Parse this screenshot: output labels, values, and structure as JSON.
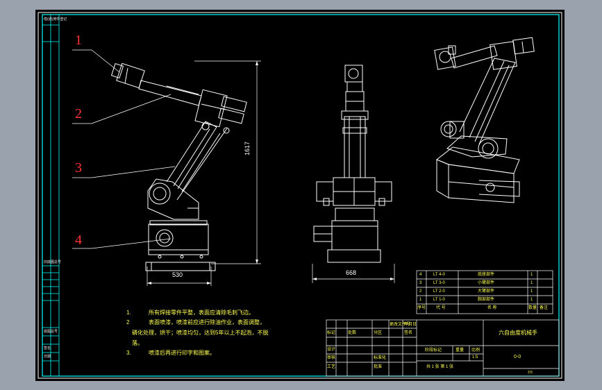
{
  "drawing": {
    "callouts": [
      "1",
      "2",
      "3",
      "4"
    ],
    "dim_width_side": "530",
    "dim_height": "1617",
    "dim_width_front": "668",
    "notes": [
      {
        "num": "1.",
        "text": "所有焊接零件平整，表面应清除毛刺飞边。"
      },
      {
        "num": "2",
        "text": "表面喷漆，喷漆前应进行除油作业，表面调整，"
      },
      {
        "num": "",
        "text": "磷化处理，烘干；喷漆均匀，达到5年以上不起泡，不脱"
      },
      {
        "num": "",
        "text": "落。"
      },
      {
        "num": "3.",
        "text": "喷漆后再进行印字和图案。"
      }
    ]
  },
  "bom": {
    "rows": [
      {
        "no": "4",
        "code": "LT 4-0",
        "name": "底座部件",
        "qty": "1"
      },
      {
        "no": "3",
        "code": "LT 3-0",
        "name": "小臂部件",
        "qty": "1"
      },
      {
        "no": "2",
        "code": "LT 2-0",
        "name": "大臂部件",
        "qty": "1"
      },
      {
        "no": "1",
        "code": "LT 1-0",
        "name": "腕部部件",
        "qty": "1"
      }
    ],
    "header": {
      "no": "序号",
      "code": "代 号",
      "name": "名  称",
      "qty": "数量",
      "note": "备注"
    }
  },
  "title_block": {
    "title": "六自由度机械手",
    "drawing_no": "0-0",
    "scale": "1:5",
    "stage_label": "阶段标记",
    "weight_label": "重量",
    "scale_label": "比例",
    "sheet_text": "共 1 张  第 1 张",
    "rev_labels": [
      "标记",
      "处数",
      "分区",
      "更改文件号",
      "签名",
      "年月日"
    ],
    "sign_labels": [
      "设计",
      "审核",
      "工艺"
    ],
    "std_labels": [
      "标准化",
      "批准"
    ],
    "corner_text": "3:5"
  },
  "side_labels": [
    "借(通)用件登记",
    "旧底图总号",
    "底图总号",
    "签名",
    "日期"
  ]
}
